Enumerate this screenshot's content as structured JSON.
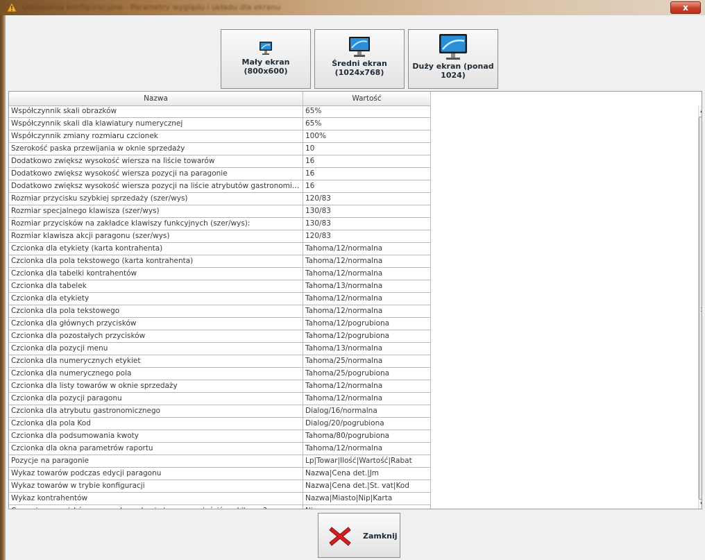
{
  "window": {
    "title": "Ustawienia konfiguracyjne - Parametry wyglądu i układu dla ekranu",
    "close_glyph": "x"
  },
  "screen_buttons": [
    {
      "line1": "Mały ekran",
      "line2": "(800x600)",
      "icon": "small-monitor-icon"
    },
    {
      "line1": "Średni ekran",
      "line2": "(1024x768)",
      "icon": "medium-monitor-icon"
    },
    {
      "line1": "Duży ekran (ponad",
      "line2": "1024)",
      "icon": "large-monitor-icon"
    }
  ],
  "table": {
    "columns": [
      "Nazwa",
      "Wartość"
    ],
    "rows": [
      [
        "Współczynnik skali obrazków",
        "65%"
      ],
      [
        "Współczynnik skali dla klawiatury numerycznej",
        "65%"
      ],
      [
        "Współczynnik zmiany rozmiaru czcionek",
        "100%"
      ],
      [
        "Szerokość paska przewijania w oknie sprzedaży",
        "10"
      ],
      [
        "Dodatkowo zwiększ wysokość wiersza na liście towarów",
        "16"
      ],
      [
        "Dodatkowo zwiększ wysokość wiersza pozycji na paragonie",
        "16"
      ],
      [
        "Dodatkowo zwiększ wysokość wiersza pozycji na liście atrybutów gastronomiczn...",
        "16"
      ],
      [
        "Rozmiar przycisku szybkiej sprzedaży (szer/wys)",
        "120/83"
      ],
      [
        "Rozmiar specjalnego klawisza (szer/wys)",
        "130/83"
      ],
      [
        "Rozmiar przycisków na zakładce klawiszy funkcyjnych (szer/wys):",
        "130/83"
      ],
      [
        "Rozmiar klawisza akcji paragonu (szer/wys)",
        "120/83"
      ],
      [
        "Czcionka dla etykiety (karta kontrahenta)",
        "Tahoma/12/normalna"
      ],
      [
        "Czcionka dla pola tekstowego (karta kontrahenta)",
        "Tahoma/12/normalna"
      ],
      [
        "Czcionka dla tabelki kontrahentów",
        "Tahoma/12/normalna"
      ],
      [
        "Czcionka dla tabelek",
        "Tahoma/13/normalna"
      ],
      [
        "Czcionka dla etykiety",
        "Tahoma/12/normalna"
      ],
      [
        "Czcionka dla pola tekstowego",
        "Tahoma/12/normalna"
      ],
      [
        "Czcionka dla głównych przycisków",
        "Tahoma/12/pogrubiona"
      ],
      [
        "Czcionka dla pozostałych przycisków",
        "Tahoma/12/pogrubiona"
      ],
      [
        "Czcionka dla pozycji menu",
        "Tahoma/13/normalna"
      ],
      [
        "Czcionka dla numerycznych etykiet",
        "Tahoma/25/normalna"
      ],
      [
        "Czcionka dla numerycznego pola",
        "Tahoma/25/pogrubiona"
      ],
      [
        "Czcionka dla listy towarów w oknie sprzedaży",
        "Tahoma/12/normalna"
      ],
      [
        "Czcionka dla pozycji paragonu",
        "Tahoma/12/normalna"
      ],
      [
        "Czcionka dla atrybutu gastronomicznego",
        "Dialog/16/normalna"
      ],
      [
        "Czcionka dla pola Kod",
        "Dialog/20/pogrubiona"
      ],
      [
        "Czcionka dla podsumowania kwoty",
        "Tahoma/80/pogrubiona"
      ],
      [
        "Czcionka dla okna parametrów raportu",
        "Tahoma/12/normalna"
      ],
      [
        "Pozycje na paragonie",
        "Lp|Towar|Ilość|Wartość|Rabat"
      ],
      [
        "Wykaz towarów podczas edycji paragonu",
        "Nazwa|Cena det.|Jm"
      ],
      [
        "Wykaz towarów w trybie konfiguracji",
        "Nazwa|Cena det.|St. vat|Kod"
      ],
      [
        "Wykaz kontrahentów",
        "Nazwa|Miasto|Nip|Karta"
      ],
      [
        "Czy opisy przycisków na panelu szukania towaru umieścić pod ikoną ?",
        "Nie"
      ]
    ]
  },
  "footer": {
    "close_label": "Zamknij",
    "close_icon": "red-x-icon"
  },
  "colors": {
    "close_red": "#d22020",
    "monitor_blue": "#2a8fd8"
  }
}
